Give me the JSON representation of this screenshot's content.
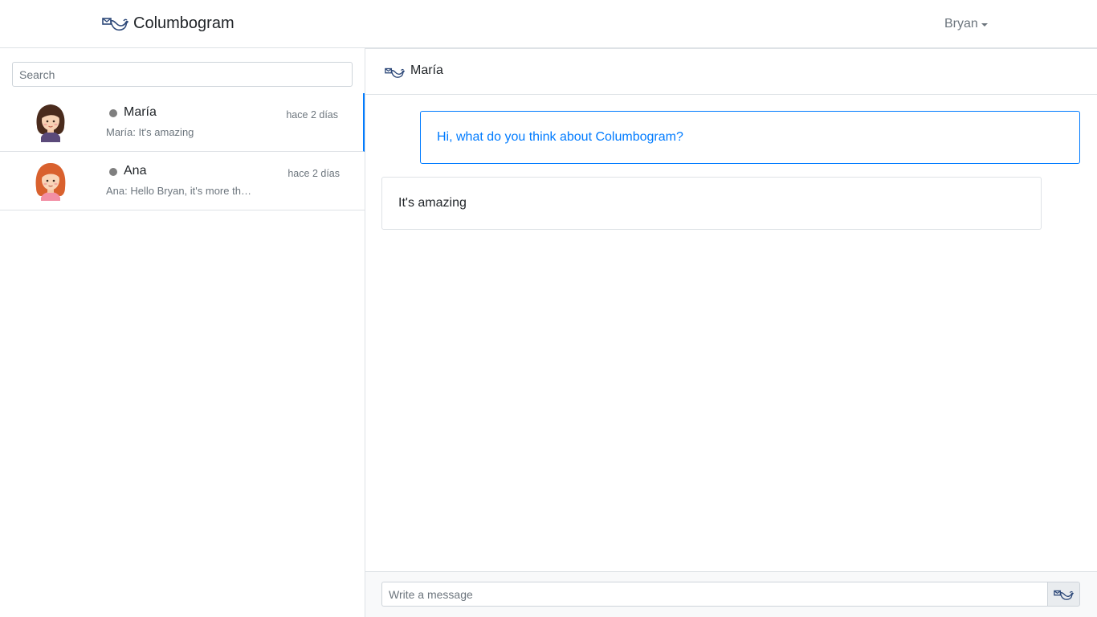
{
  "navbar": {
    "brand_name": "Columbogram",
    "brand_icon": "pigeon-letter-icon",
    "user_name": "Bryan"
  },
  "sidebar": {
    "search_placeholder": "Search",
    "chats": [
      {
        "name": "María",
        "time": "hace 2 días",
        "preview": "María: It's amazing",
        "status": "offline",
        "avatar": "avatar-brown-hair-icon",
        "active": true
      },
      {
        "name": "Ana",
        "time": "hace 2 días",
        "preview": "Ana: Hello Bryan, it's more than amazing",
        "status": "offline",
        "avatar": "avatar-red-hair-icon",
        "active": false
      }
    ]
  },
  "conversation": {
    "contact_name": "María",
    "messages": [
      {
        "direction": "outgoing",
        "text": "Hi, what do you think about Columbogram?"
      },
      {
        "direction": "incoming",
        "text": "It's amazing"
      }
    ],
    "composer_placeholder": "Write a message",
    "send_icon": "pigeon-letter-icon"
  },
  "colors": {
    "accent": "#007bff",
    "border": "#dee2e6",
    "muted": "#6c757d",
    "status_offline": "#7f7f7f",
    "brand_icon": "#2f4a7a"
  }
}
